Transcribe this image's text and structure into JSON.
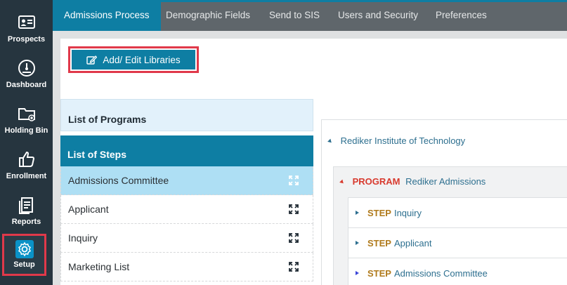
{
  "sidebar": {
    "items": [
      {
        "label": "Prospects",
        "icon": "id-card-icon"
      },
      {
        "label": "Dashboard",
        "icon": "speedometer-icon"
      },
      {
        "label": "Holding Bin",
        "icon": "folder-add-icon"
      },
      {
        "label": "Enrollment",
        "icon": "thumbs-up-icon"
      },
      {
        "label": "Reports",
        "icon": "report-icon"
      },
      {
        "label": "Setup",
        "icon": "gear-icon",
        "active": true
      }
    ]
  },
  "topnav": {
    "tabs": [
      {
        "label": "Admissions Process",
        "active": true
      },
      {
        "label": "Demographic Fields"
      },
      {
        "label": "Send to SIS"
      },
      {
        "label": "Users and Security"
      },
      {
        "label": "Preferences"
      }
    ]
  },
  "toolbar": {
    "add_edit_label": "Add/ Edit Libraries",
    "add_edit_icon": "edit-icon"
  },
  "left_panel": {
    "programs_header": "List of Programs",
    "steps_header": "List of Steps",
    "steps": [
      {
        "label": "Admissions Committee",
        "selected": true
      },
      {
        "label": "Applicant"
      },
      {
        "label": "Inquiry"
      },
      {
        "label": "Marketing List"
      }
    ],
    "expand_icon": "expand-arrows-icon"
  },
  "tree": {
    "root": "Rediker Institute of Technology",
    "program_keyword": "PROGRAM",
    "program_name": "Rediker Admissions",
    "step_keyword": "STEP",
    "steps": [
      "Inquiry",
      "Applicant",
      "Admissions Committee"
    ]
  },
  "colors": {
    "sidebar_bg": "#26353f",
    "accent": "#0e7ea3",
    "highlight_border": "#e0394a",
    "selected_row": "#aedff4",
    "program_keyword": "#d83a2e",
    "step_keyword": "#b07a1b"
  }
}
